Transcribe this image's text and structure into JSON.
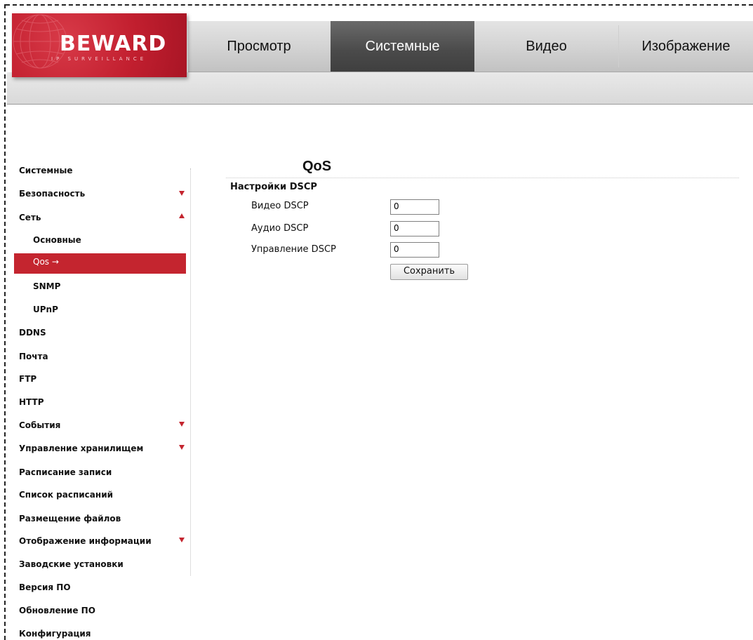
{
  "header": {
    "logo": {
      "brand": "BEWARD",
      "tagline": "IP SURVEILLANCE"
    },
    "tabs": [
      {
        "label": "Просмотр",
        "active": false
      },
      {
        "label": "Системные",
        "active": true
      },
      {
        "label": "Видео",
        "active": false
      },
      {
        "label": "Изображение",
        "active": false
      }
    ]
  },
  "sidebar": {
    "items": [
      {
        "label": "Системные"
      },
      {
        "label": "Безопасность",
        "expand": "down"
      },
      {
        "label": "Сеть",
        "expand": "up"
      },
      {
        "label": "Основные",
        "sub": true
      },
      {
        "label": "Qos",
        "sub": true,
        "active": true,
        "arrow": "→"
      },
      {
        "label": "SNMP",
        "sub": true
      },
      {
        "label": "UPnP",
        "sub": true
      },
      {
        "label": "DDNS"
      },
      {
        "label": "Почта"
      },
      {
        "label": "FTP"
      },
      {
        "label": "HTTP"
      },
      {
        "label": "События",
        "expand": "down"
      },
      {
        "label": "Управление хранилищем",
        "expand": "down"
      },
      {
        "label": "Расписание записи"
      },
      {
        "label": "Список расписаний"
      },
      {
        "label": "Размещение файлов"
      },
      {
        "label": "Отображение информации",
        "expand": "down"
      },
      {
        "label": "Заводские установки"
      },
      {
        "label": "Версия ПО"
      },
      {
        "label": "Обновление ПО"
      },
      {
        "label": "Конфигурация"
      }
    ]
  },
  "main": {
    "title": "QoS",
    "section_title": "Настройки DSCP",
    "fields": [
      {
        "label": "Видео DSCP",
        "value": "0"
      },
      {
        "label": "Аудио DSCP",
        "value": "0"
      },
      {
        "label": "Управление DSCP",
        "value": "0"
      }
    ],
    "save_label": "Сохранить"
  },
  "colors": {
    "accent_red": "#c4252f",
    "active_tab": "#4a4a4a"
  }
}
